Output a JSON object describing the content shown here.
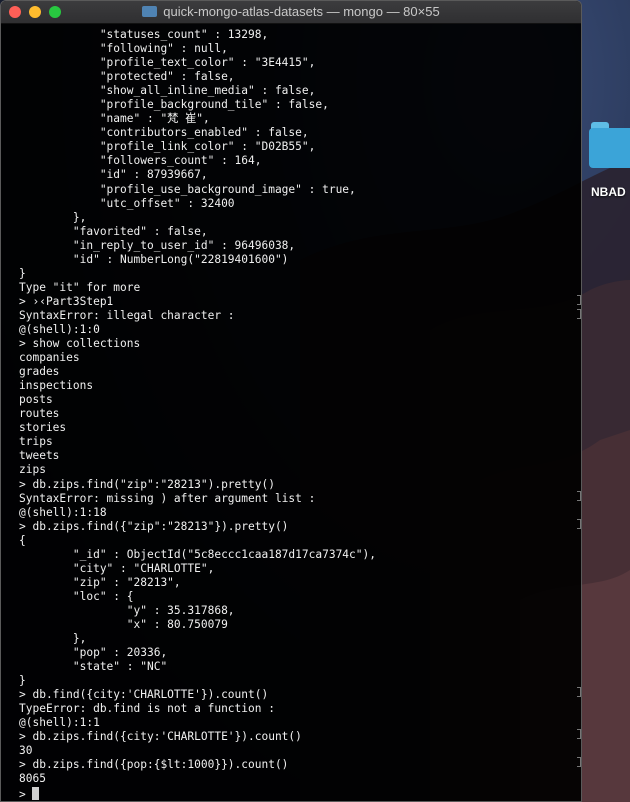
{
  "window": {
    "title": "quick-mongo-atlas-datasets — mongo — 80×55"
  },
  "desktop": {
    "folder_label": "NBAD"
  },
  "terminal": {
    "lines": [
      "            \"statuses_count\" : 13298,",
      "            \"following\" : null,",
      "            \"profile_text_color\" : \"3E4415\",",
      "            \"protected\" : false,",
      "            \"show_all_inline_media\" : false,",
      "            \"profile_background_tile\" : false,",
      "            \"name\" : \"梵 崔\",",
      "            \"contributors_enabled\" : false,",
      "            \"profile_link_color\" : \"D02B55\",",
      "            \"followers_count\" : 164,",
      "            \"id\" : 87939667,",
      "            \"profile_use_background_image\" : true,",
      "            \"utc_offset\" : 32400",
      "        },",
      "        \"favorited\" : false,",
      "        \"in_reply_to_user_id\" : 96496038,",
      "        \"id\" : NumberLong(\"22819401600\")",
      "}",
      "Type \"it\" for more",
      "> ›‹Part3Step1",
      "SyntaxError: illegal character :",
      "@(shell):1:0",
      "> show collections",
      "companies",
      "grades",
      "inspections",
      "posts",
      "routes",
      "stories",
      "trips",
      "tweets",
      "zips",
      "> db.zips.find(\"zip\":\"28213\").pretty()",
      "SyntaxError: missing ) after argument list :",
      "@(shell):1:18",
      "> db.zips.find({\"zip\":\"28213\"}).pretty()",
      "{",
      "        \"_id\" : ObjectId(\"5c8eccc1caa187d17ca7374c\"),",
      "        \"city\" : \"CHARLOTTE\",",
      "        \"zip\" : \"28213\",",
      "        \"loc\" : {",
      "                \"y\" : 35.317868,",
      "                \"x\" : 80.750079",
      "        },",
      "        \"pop\" : 20336,",
      "        \"state\" : \"NC\"",
      "}",
      "> db.find({city:'CHARLOTTE'}).count()",
      "TypeError: db.find is not a function :",
      "@(shell):1:1",
      "> db.zips.find({city:'CHARLOTTE'}).count()",
      "30",
      "> db.zips.find({pop:{$lt:1000}}).count()",
      "8065",
      "> "
    ]
  }
}
